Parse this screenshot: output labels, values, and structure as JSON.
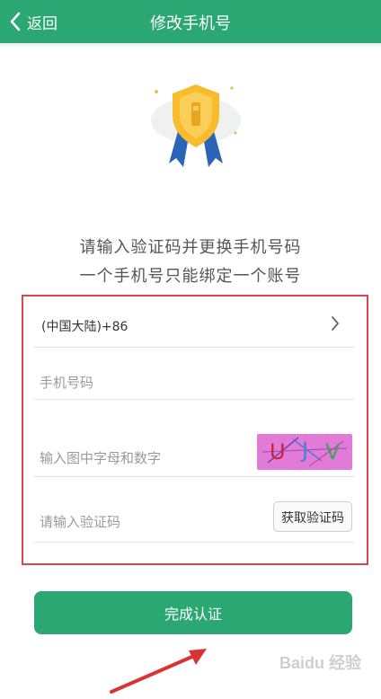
{
  "header": {
    "back_label": "返回",
    "title": "修改手机号"
  },
  "description": {
    "line1": "请输入验证码并更换手机号码",
    "line2": "一个手机号只能绑定一个账号"
  },
  "form": {
    "region_value": "(中国大陆)+86",
    "phone_placeholder": "手机号码",
    "captcha_placeholder": "输入图中字母和数字",
    "captcha_chars": [
      "U",
      "J",
      "V"
    ],
    "code_placeholder": "请输入验证码",
    "get_code_label": "获取验证码"
  },
  "submit_label": "完成认证",
  "watermark": "Baidu 经验",
  "colors": {
    "primary": "#2aa773",
    "highlight_box": "#d84a4a",
    "captcha_bg": "#e27ad8"
  },
  "icons": {
    "back": "chevron-left-icon",
    "badge": "shield-badge-icon",
    "region": "chevron-right-icon"
  }
}
